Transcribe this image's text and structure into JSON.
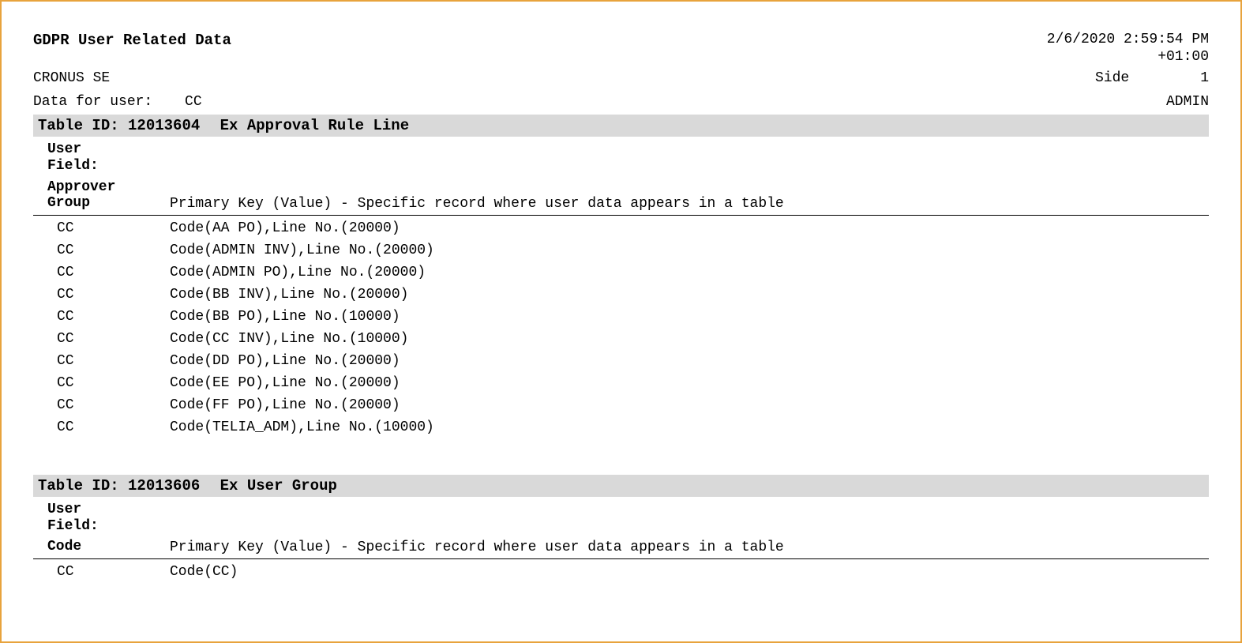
{
  "header": {
    "title": "GDPR User Related Data",
    "timestamp_line1": "2/6/2020 2:59:54 PM",
    "timestamp_line2": "+01:00",
    "company": "CRONUS SE",
    "side_label": "Side",
    "side_value": "1",
    "data_for_user_label": "Data for user:",
    "data_for_user_value": "CC",
    "admin": "ADMIN"
  },
  "sections": [
    {
      "table_id_label": "Table ID:",
      "table_id": "12013604",
      "table_name": "Ex Approval Rule Line",
      "user_field_l1": "User",
      "user_field_l2": "Field:",
      "key_field_l1": "Approver",
      "key_field_l2": "Group",
      "key_desc": "Primary Key (Value) - Specific record where user data appears in a table",
      "rows": [
        {
          "c1": "CC",
          "c2": "Code(AA PO),Line No.(20000)"
        },
        {
          "c1": "CC",
          "c2": "Code(ADMIN INV),Line No.(20000)"
        },
        {
          "c1": "CC",
          "c2": "Code(ADMIN PO),Line No.(20000)"
        },
        {
          "c1": "CC",
          "c2": "Code(BB INV),Line No.(20000)"
        },
        {
          "c1": "CC",
          "c2": "Code(BB PO),Line No.(10000)"
        },
        {
          "c1": "CC",
          "c2": "Code(CC INV),Line No.(10000)"
        },
        {
          "c1": "CC",
          "c2": "Code(DD PO),Line No.(20000)"
        },
        {
          "c1": "CC",
          "c2": "Code(EE PO),Line No.(20000)"
        },
        {
          "c1": "CC",
          "c2": "Code(FF PO),Line No.(20000)"
        },
        {
          "c1": "CC",
          "c2": "Code(TELIA_ADM),Line No.(10000)"
        }
      ]
    },
    {
      "table_id_label": "Table ID:",
      "table_id": "12013606",
      "table_name": "Ex User Group",
      "user_field_l1": "User",
      "user_field_l2": "Field:",
      "key_field_l1": "Code",
      "key_field_l2": "",
      "key_desc": "Primary Key (Value) - Specific record where user data appears in a table",
      "rows": [
        {
          "c1": "CC",
          "c2": "Code(CC)"
        }
      ]
    }
  ]
}
